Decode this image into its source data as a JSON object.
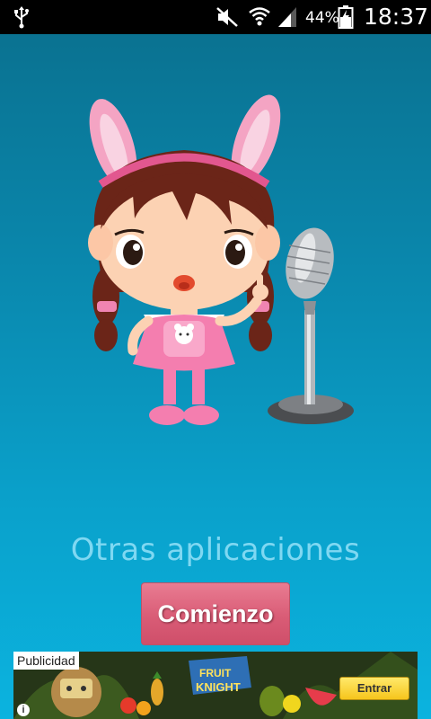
{
  "status_bar": {
    "battery_percent": "44%",
    "time": "18:37",
    "icons": [
      "usb-icon",
      "mute-icon",
      "wifi-icon",
      "signal-icon",
      "battery-charging-icon"
    ]
  },
  "main": {
    "illustration": [
      "girl-with-bunny-ears",
      "microphone"
    ],
    "other_apps_label": "Otras aplicaciones",
    "start_button_label": "Comienzo"
  },
  "ad": {
    "label": "Publicidad",
    "logo_text": "FRUIT KNIGHT",
    "cta_label": "Entrar",
    "info_icon": "i"
  },
  "colors": {
    "background_top": "#0a6f8d",
    "background_bottom": "#0bb3df",
    "button": "#d95c76",
    "label": "#7fd8f2"
  }
}
